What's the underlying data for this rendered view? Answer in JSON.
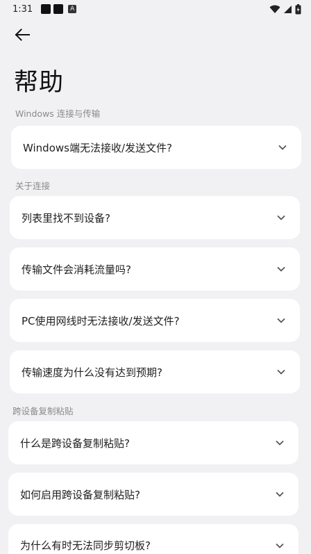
{
  "status_bar": {
    "time": "1:31",
    "notif_icon_letter": "A"
  },
  "page": {
    "title": "帮助"
  },
  "sections": [
    {
      "header": "Windows 连接与传输",
      "items": [
        {
          "label": "Windows端无法接收/发送文件?"
        }
      ]
    },
    {
      "header": "关于连接",
      "items": [
        {
          "label": "列表里找不到设备?"
        },
        {
          "label": "传输文件会消耗流量吗?"
        },
        {
          "label": "PC使用网线时无法接收/发送文件?"
        },
        {
          "label": "传输速度为什么没有达到预期?"
        }
      ]
    },
    {
      "header": "跨设备复制粘贴",
      "items": [
        {
          "label": "什么是跨设备复制粘贴?"
        },
        {
          "label": "如何启用跨设备复制粘贴?"
        },
        {
          "label": "为什么有时无法同步剪切板?"
        }
      ]
    }
  ]
}
